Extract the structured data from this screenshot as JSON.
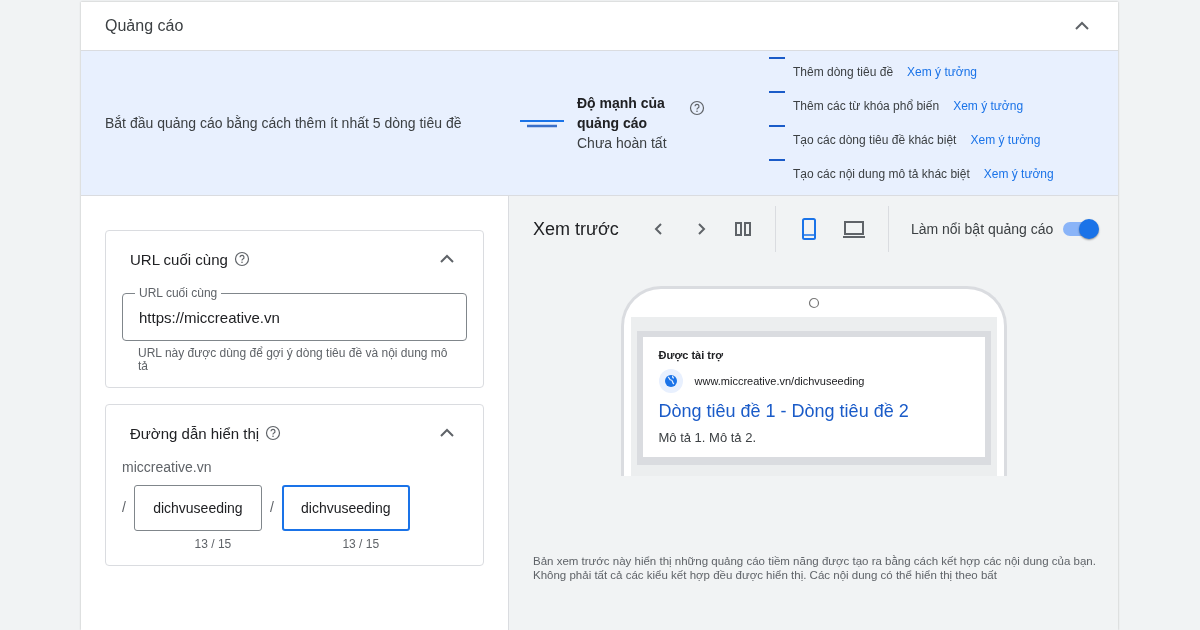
{
  "section": {
    "title": "Quảng cáo",
    "expanded": true
  },
  "strength": {
    "prompt": "Bắt đầu quảng cáo bằng cách thêm ít nhất 5 dòng tiêu đề",
    "title": "Độ mạnh của quảng cáo",
    "status": "Chưa hoàn tất",
    "tips": [
      {
        "text": "Thêm dòng tiêu đề",
        "link": "Xem ý tưởng"
      },
      {
        "text": "Thêm các từ khóa phổ biến",
        "link": "Xem ý tưởng"
      },
      {
        "text": "Tạo các dòng tiêu đề khác biệt",
        "link": "Xem ý tưởng"
      },
      {
        "text": "Tạo các nội dung mô tả khác biệt",
        "link": "Xem ý tưởng"
      }
    ]
  },
  "final_url": {
    "title": "URL cuối cùng",
    "expanded": true,
    "field_label": "URL cuối cùng",
    "value": "https://miccreative.vn",
    "hint": "URL này được dùng để gợi ý dòng tiêu đề và nội dung mô tả"
  },
  "display_path": {
    "title": "Đường dẫn hiển thị",
    "expanded": true,
    "domain": "miccreative.vn",
    "paths": [
      {
        "separator": "/",
        "value": "dichvuseeding",
        "count": "13 / 15",
        "focused": false
      },
      {
        "separator": "/",
        "value": "dichvuseeding",
        "count": "13 / 15",
        "focused": true
      }
    ]
  },
  "preview": {
    "title": "Xem trước",
    "devices": [
      {
        "kind": "mobile",
        "selected": true
      },
      {
        "kind": "desktop",
        "selected": false
      }
    ],
    "highlight": {
      "label": "Làm nổi bật quảng cáo",
      "on": true
    },
    "ad": {
      "sponsored": "Được tài trợ",
      "url": "www.miccreative.vn/dichvuseeding",
      "headline": "Dòng tiêu đề 1 - Dòng tiêu đề 2",
      "description": "Mô tả 1. Mô tả 2."
    },
    "note": "Bản xem trước này hiển thị những quảng cáo tiềm năng được tạo ra bằng cách kết hợp các nội dung của bạn. Không phải tất cả các kiểu kết hợp đều được hiển thị. Các nội dung có thể hiển thị theo bất"
  }
}
